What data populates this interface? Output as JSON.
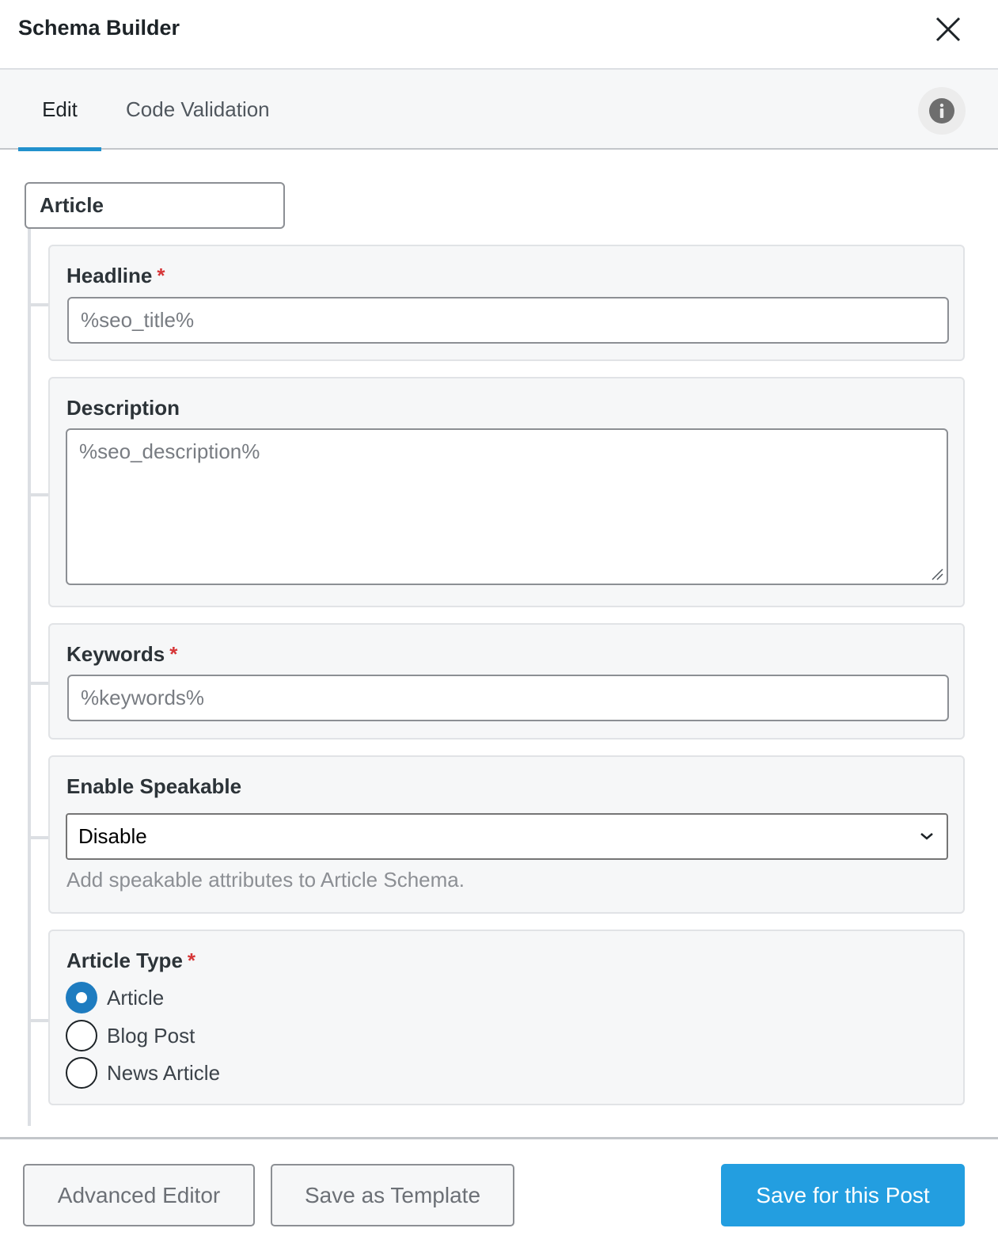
{
  "header": {
    "title": "Schema Builder",
    "close_icon": "close-icon"
  },
  "tabs": [
    {
      "label": "Edit",
      "active": true
    },
    {
      "label": "Code Validation",
      "active": false
    }
  ],
  "info_icon": "info-icon",
  "schema": {
    "type_label": "Article",
    "fields": {
      "headline": {
        "label": "Headline",
        "required": "*",
        "value": "%seo_title%"
      },
      "description": {
        "label": "Description",
        "value": "%seo_description%"
      },
      "keywords": {
        "label": "Keywords",
        "required": "*",
        "value": "%keywords%"
      },
      "speakable": {
        "label": "Enable Speakable",
        "selected": "Disable",
        "help": "Add speakable attributes to Article Schema."
      },
      "article_type": {
        "label": "Article Type",
        "required": "*",
        "options": [
          {
            "label": "Article",
            "checked": true
          },
          {
            "label": "Blog Post",
            "checked": false
          },
          {
            "label": "News Article",
            "checked": false
          }
        ]
      }
    }
  },
  "footer": {
    "advanced_editor": "Advanced Editor",
    "save_template": "Save as Template",
    "save_post": "Save for this Post"
  },
  "colors": {
    "accent": "#2291cd",
    "primary_button": "#239ee0",
    "required": "#d63638",
    "radio_checked": "#1e7cc0"
  }
}
